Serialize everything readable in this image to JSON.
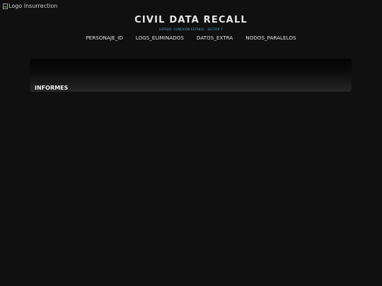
{
  "logo": {
    "alt_text": "Logo Insurrection",
    "icon": "broken-image-icon"
  },
  "header": {
    "title": "CIVIL DATA RECALL",
    "status": "ESTADO: CONEXIÓN ESTABLE · SECTOR 7"
  },
  "nav": {
    "items": [
      {
        "label": "PERSONAJE_ID"
      },
      {
        "label": "LOGS_ELIMINADOS"
      },
      {
        "label": "DATOS_EXTRA"
      },
      {
        "label": "NODOS_PARALELOS"
      }
    ]
  },
  "panel": {
    "heading": "INFORMES"
  },
  "colors": {
    "background": "#101010",
    "status_accent": "#4aa6c9",
    "text": "#e6e6e6"
  }
}
